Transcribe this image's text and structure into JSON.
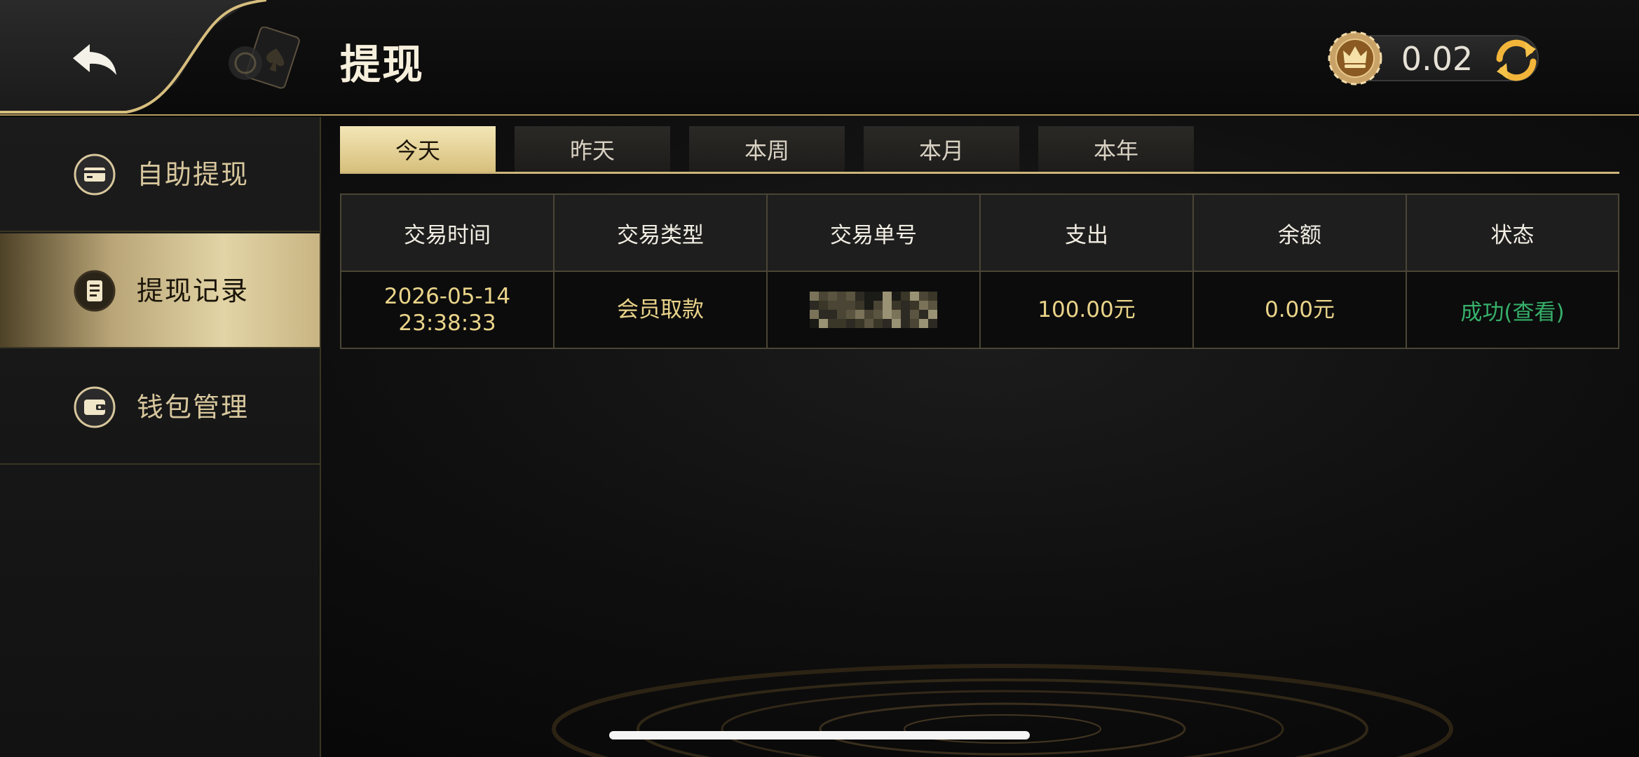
{
  "header": {
    "title": "提现",
    "balance": "0.02"
  },
  "sidebar": {
    "items": [
      {
        "label": "自助提现",
        "icon": "card-icon",
        "active": false
      },
      {
        "label": "提现记录",
        "icon": "records-icon",
        "active": true
      },
      {
        "label": "钱包管理",
        "icon": "wallet-icon",
        "active": false
      }
    ]
  },
  "tabs": [
    {
      "label": "今天",
      "active": true
    },
    {
      "label": "昨天",
      "active": false
    },
    {
      "label": "本周",
      "active": false
    },
    {
      "label": "本月",
      "active": false
    },
    {
      "label": "本年",
      "active": false
    }
  ],
  "table": {
    "columns": [
      "交易时间",
      "交易类型",
      "交易单号",
      "支出",
      "余额",
      "状态"
    ],
    "rows": [
      {
        "time_date": "2026-05-14",
        "time_clock": "23:38:33",
        "type": "会员取款",
        "order_no": "",
        "expense": "100.00元",
        "balance": "0.00元",
        "status": "成功(查看)"
      }
    ]
  },
  "colors": {
    "accent_gold": "#cdb67a",
    "value_gold": "#ead48a",
    "status_green": "#36b06a",
    "background": "#0a0a0a"
  }
}
